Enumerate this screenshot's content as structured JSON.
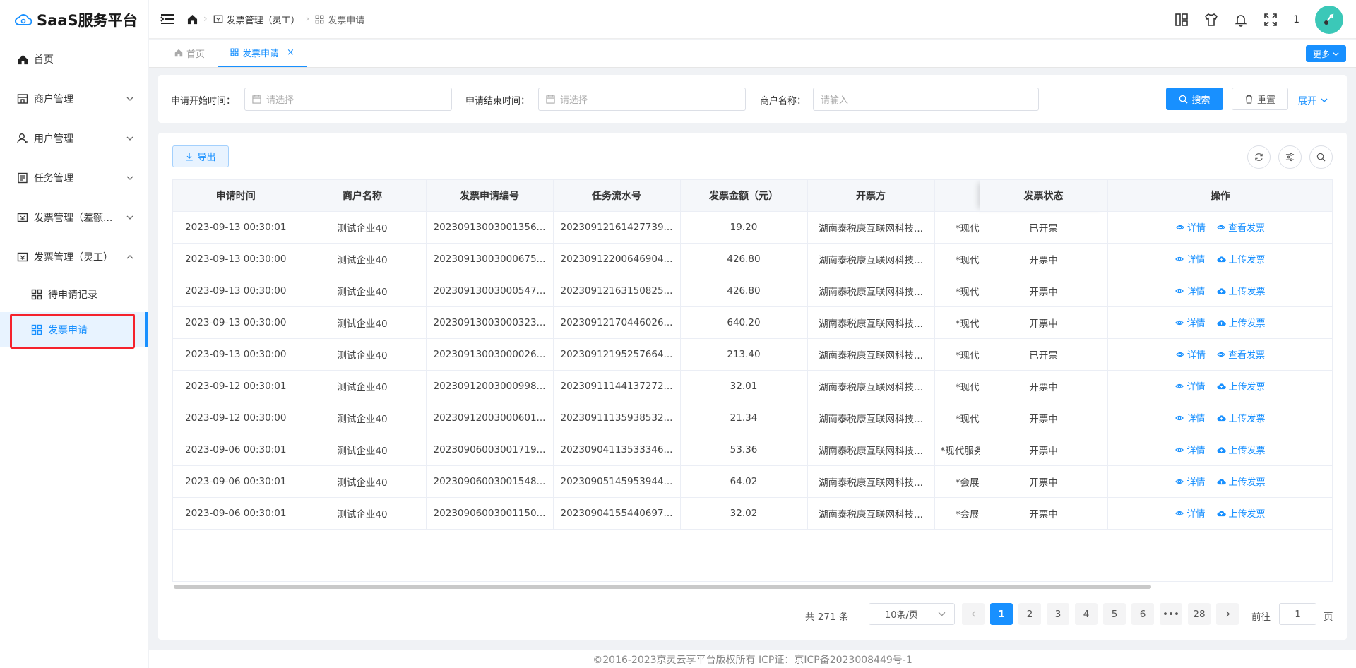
{
  "app": {
    "title": "SaaS服务平台"
  },
  "sidebar": {
    "items": [
      {
        "label": "首页",
        "icon": "home-icon"
      },
      {
        "label": "商户管理",
        "icon": "shop-icon"
      },
      {
        "label": "用户管理",
        "icon": "user-icon"
      },
      {
        "label": "任务管理",
        "icon": "task-icon"
      },
      {
        "label": "发票管理（差额...",
        "icon": "invoice-icon"
      },
      {
        "label": "发票管理（灵工）",
        "icon": "invoice-icon"
      }
    ],
    "subitems": [
      {
        "label": "待申请记录",
        "icon": "grid-icon"
      },
      {
        "label": "发票申请",
        "icon": "grid-icon",
        "active": true
      }
    ]
  },
  "header": {
    "breadcrumb": [
      "发票管理（灵工）",
      "发票申请"
    ],
    "user_count": "1"
  },
  "tabs": [
    {
      "label": "首页"
    },
    {
      "label": "发票申请",
      "active": true
    }
  ],
  "more_label": "更多",
  "search": {
    "start_label": "申请开始时间：",
    "start_placeholder": "请选择",
    "end_label": "申请结束时间：",
    "end_placeholder": "请选择",
    "merchant_label": "商户名称：",
    "merchant_placeholder": "请输入",
    "search_btn": "搜索",
    "reset_btn": "重置",
    "expand_btn": "展开"
  },
  "toolbar": {
    "export_btn": "导出"
  },
  "table": {
    "headers": [
      "申请时间",
      "商户名称",
      "发票申请编号",
      "任务流水号",
      "发票金额（元）",
      "开票方",
      "",
      "发票状态",
      "操作"
    ],
    "rows": [
      [
        "2023-09-13 00:30:01",
        "测试企业40",
        "20230913003001356...",
        "20230912161427739...",
        "19.20",
        "湖南泰税康互联网科技...",
        "*现代",
        "已开票",
        "详情",
        "查看发票"
      ],
      [
        "2023-09-13 00:30:00",
        "测试企业40",
        "20230913003000675...",
        "20230912200646904...",
        "426.80",
        "湖南泰税康互联网科技...",
        "*现代",
        "开票中",
        "详情",
        "上传发票"
      ],
      [
        "2023-09-13 00:30:00",
        "测试企业40",
        "20230913003000547...",
        "20230912163150825...",
        "426.80",
        "湖南泰税康互联网科技...",
        "*现代",
        "开票中",
        "详情",
        "上传发票"
      ],
      [
        "2023-09-13 00:30:00",
        "测试企业40",
        "20230913003000323...",
        "20230912170446026...",
        "640.20",
        "湖南泰税康互联网科技...",
        "*现代",
        "开票中",
        "详情",
        "上传发票"
      ],
      [
        "2023-09-13 00:30:00",
        "测试企业40",
        "20230913003000026...",
        "20230912195257664...",
        "213.40",
        "湖南泰税康互联网科技...",
        "*现代",
        "已开票",
        "详情",
        "查看发票"
      ],
      [
        "2023-09-12 00:30:01",
        "测试企业40",
        "20230912003000998...",
        "20230911144137272...",
        "32.01",
        "湖南泰税康互联网科技...",
        "*现代",
        "开票中",
        "详情",
        "上传发票"
      ],
      [
        "2023-09-12 00:30:00",
        "测试企业40",
        "20230912003000601...",
        "20230911135938532...",
        "21.34",
        "湖南泰税康互联网科技...",
        "*现代",
        "开票中",
        "详情",
        "上传发票"
      ],
      [
        "2023-09-06 00:30:01",
        "测试企业40",
        "20230906003001719...",
        "20230904113533346...",
        "53.36",
        "湖南泰税康互联网科技...",
        "*现代服务",
        "开票中",
        "详情",
        "上传发票"
      ],
      [
        "2023-09-06 00:30:01",
        "测试企业40",
        "20230906003001548...",
        "20230905145953944...",
        "64.02",
        "湖南泰税康互联网科技...",
        "*会展",
        "开票中",
        "详情",
        "上传发票"
      ],
      [
        "2023-09-06 00:30:01",
        "测试企业40",
        "20230906003001150...",
        "20230904155440697...",
        "32.02",
        "湖南泰税康互联网科技...",
        "*会展",
        "开票中",
        "详情",
        "上传发票"
      ]
    ]
  },
  "pagination": {
    "total": "共 271 条",
    "page_size": "10条/页",
    "pages": [
      "1",
      "2",
      "3",
      "4",
      "5",
      "6",
      "•••",
      "28"
    ],
    "goto_label": "前往",
    "goto_value": "1",
    "goto_unit": "页"
  },
  "footer": {
    "text": "©2016-2023京灵云享平台版权所有 ICP证：京ICP备2023008449号-1"
  },
  "colors": {
    "accent": "#1890ff",
    "highlight": "#f5222d"
  }
}
